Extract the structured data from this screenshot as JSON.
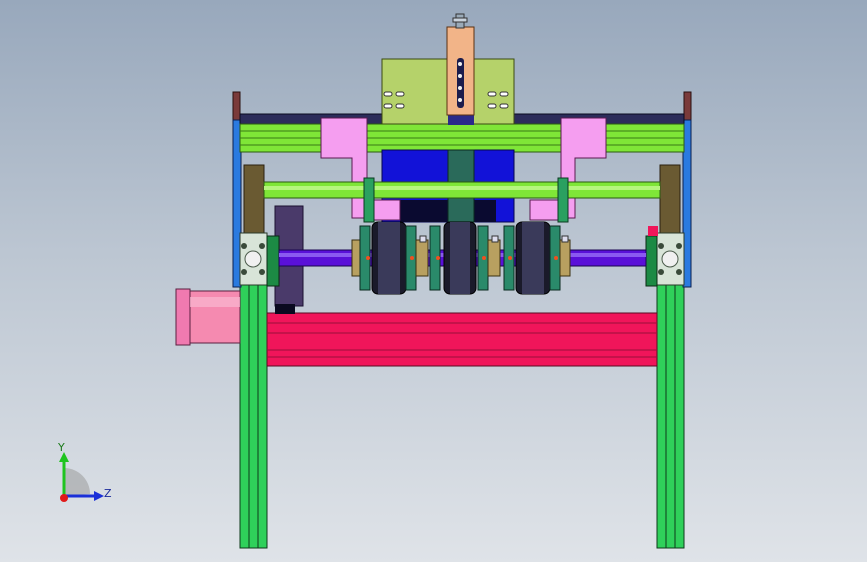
{
  "view": {
    "triad": {
      "y_label": "Y",
      "z_label": "Z",
      "y_color": "#1fc41f",
      "z_color": "#1a2fd8",
      "x_color": "#e01a1a"
    }
  },
  "colors": {
    "background_top": "#98a8bc",
    "background_bottom": "#dfe3e8",
    "leg_green": "#2fd05a",
    "rail_red": "#f0155a",
    "rail_lime": "#7fe637",
    "block_olive": "#b5d26a",
    "bracket_pink": "#f59ef0",
    "motor_pink": "#f58ab0",
    "block_blue": "#1212d8",
    "shaft_purple": "#5a10d8",
    "slider_peach": "#f2b488",
    "frame_navy": "#1c1c4c"
  }
}
